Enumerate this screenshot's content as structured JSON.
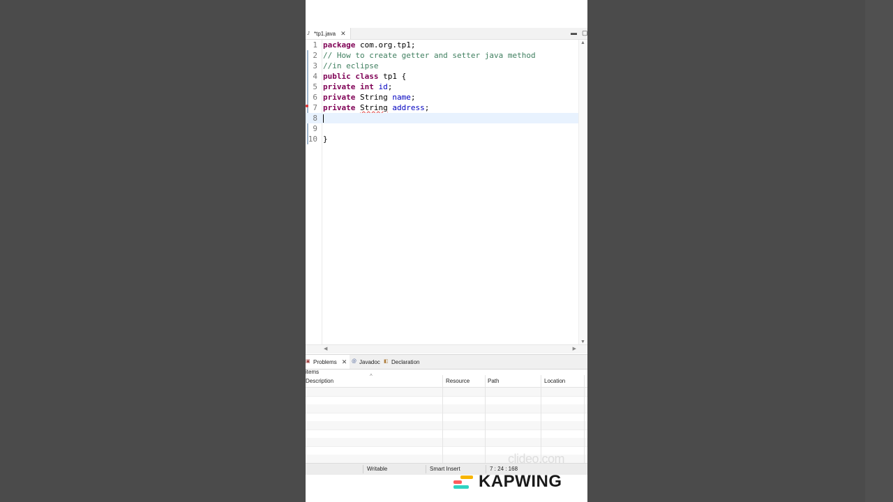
{
  "editor": {
    "tab_label": "*tp1.java",
    "tab_icon": "java-file-icon",
    "lines": [
      {
        "n": "1",
        "tokens": [
          {
            "t": "package",
            "c": "kw"
          },
          {
            "t": " com.org.tp1;",
            "c": ""
          }
        ]
      },
      {
        "n": "2",
        "tokens": [
          {
            "t": "// How to create getter and setter java method",
            "c": "cm"
          }
        ]
      },
      {
        "n": "3",
        "tokens": [
          {
            "t": "//in eclipse",
            "c": "cm"
          }
        ]
      },
      {
        "n": "4",
        "tokens": [
          {
            "t": "public",
            "c": "kw"
          },
          {
            "t": " ",
            "c": ""
          },
          {
            "t": "class",
            "c": "kw"
          },
          {
            "t": " tp1 {",
            "c": ""
          }
        ]
      },
      {
        "n": "5",
        "tokens": [
          {
            "t": "private",
            "c": "kw"
          },
          {
            "t": " ",
            "c": ""
          },
          {
            "t": "int",
            "c": "kw"
          },
          {
            "t": " ",
            "c": ""
          },
          {
            "t": "id",
            "c": "fld"
          },
          {
            "t": ";",
            "c": ""
          }
        ]
      },
      {
        "n": "6",
        "tokens": [
          {
            "t": "private",
            "c": "kw"
          },
          {
            "t": " String ",
            "c": ""
          },
          {
            "t": "name",
            "c": "fld"
          },
          {
            "t": ";",
            "c": ""
          }
        ]
      },
      {
        "n": "7",
        "tokens": [
          {
            "t": "private",
            "c": "kw"
          },
          {
            "t": " ",
            "c": ""
          },
          {
            "t": "String",
            "c": "err"
          },
          {
            "t": " ",
            "c": ""
          },
          {
            "t": "address",
            "c": "fld"
          },
          {
            "t": ";",
            "c": ""
          }
        ]
      },
      {
        "n": "8",
        "tokens": []
      },
      {
        "n": "9",
        "tokens": []
      },
      {
        "n": "10",
        "tokens": [
          {
            "t": "}",
            "c": ""
          }
        ]
      }
    ],
    "current_line": 8
  },
  "panel": {
    "tabs": [
      {
        "label": "Problems",
        "icon": "problems-icon",
        "active": true
      },
      {
        "label": "Javadoc",
        "icon": "javadoc-icon",
        "active": false
      },
      {
        "label": "Declaration",
        "icon": "declaration-icon",
        "active": false
      }
    ],
    "items_label": "items",
    "columns": [
      "Description",
      "Resource",
      "Path",
      "Location"
    ]
  },
  "status": {
    "writable": "Writable",
    "insert_mode": "Smart Insert",
    "position": "7 : 24 : 168"
  },
  "watermark": "clideo.com",
  "logo": {
    "text": "KAPWING",
    "colors": [
      "#f7b500",
      "#ff5c5c",
      "#2fd3c1"
    ]
  }
}
